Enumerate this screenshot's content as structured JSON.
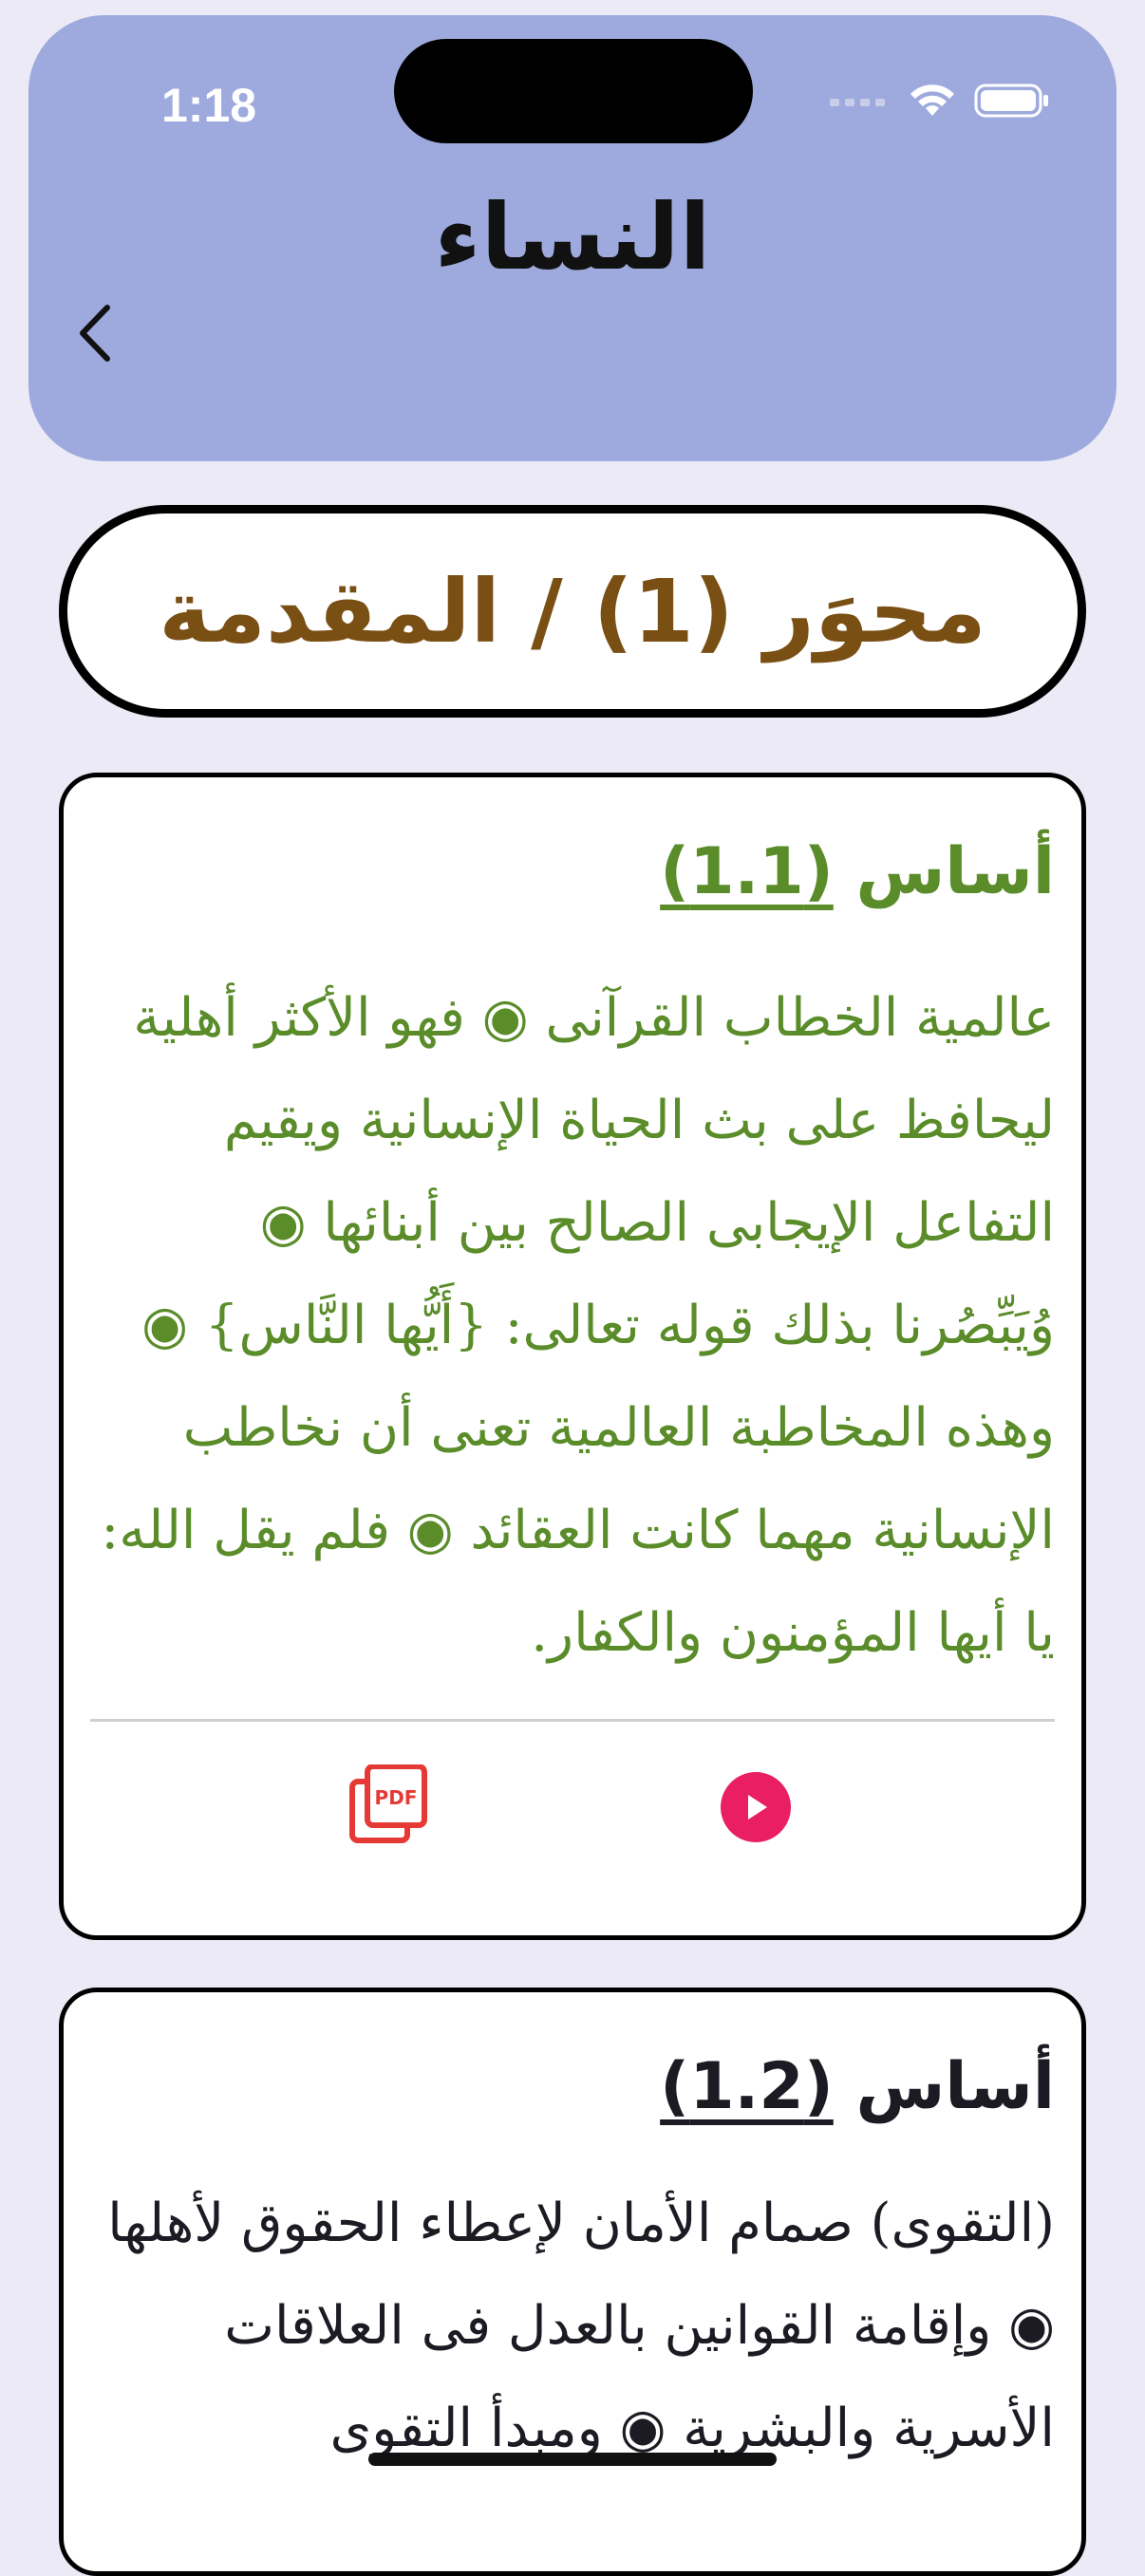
{
  "status_bar": {
    "time": "1:18"
  },
  "header": {
    "title": "النساء",
    "back_icon": "chevron-left-icon"
  },
  "section": {
    "title": "محوَر (1) / المقدمة"
  },
  "cards": [
    {
      "label": "أساس",
      "number": "(1.1)",
      "body": "عالمية الخطاب القرآنى ◉ فهو الأكثر أهلية ليحافظ على بث الحياة الإنسانية ويقيم التفاعل الإيجابى الصالح بين أبنائها ◉ وُيَبِّصُرنا بذلك قوله تعالى: {أَيُّها النَّاس} ◉ وهذه المخاطبة العالمية تعنى أن نخاطب الإنسانية مهما كانت العقائد ◉ فلم يقل الله: يا أيها المؤمنون والكفار.",
      "color": "#5a8c2a",
      "actions": {
        "pdf_icon": "pdf-icon",
        "play_icon": "play-icon"
      }
    },
    {
      "label": "أساس",
      "number": "(1.2)",
      "body": "(التقوى) صمام الأمان لإعطاء الحقوق لأهلها ◉ وإقامة القوانين بالعدل فى العلاقات الأسرية والبشرية ◉ ومبدأ التقوى",
      "color": "#1c1a22"
    }
  ],
  "colors": {
    "header_bg": "#9eaadd",
    "page_bg": "#ebeaf6",
    "section_title": "#7a4f14",
    "play_button": "#e91e63",
    "pdf_icon": "#e53935"
  }
}
